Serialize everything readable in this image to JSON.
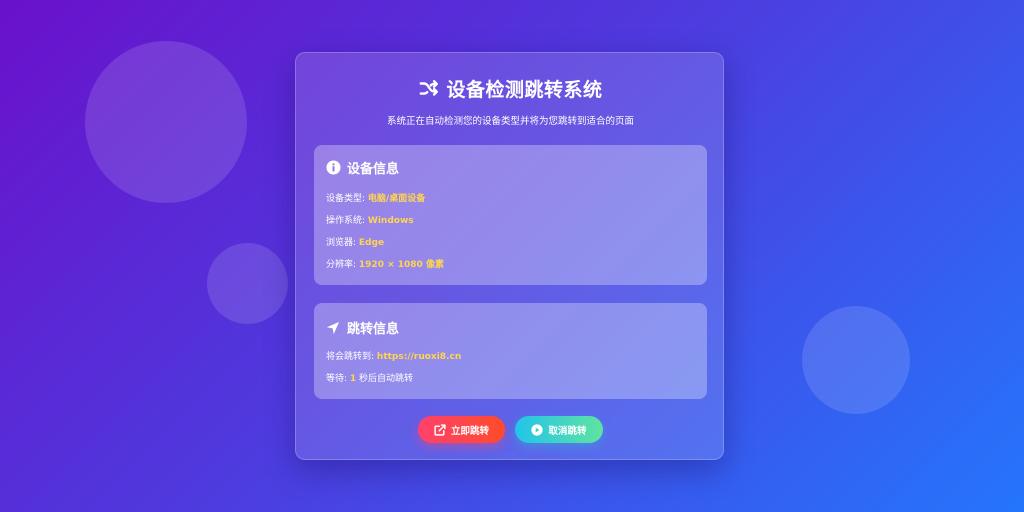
{
  "header": {
    "title": "设备检测跳转系统",
    "subtitle": "系统正在自动检测您的设备类型并将为您跳转到适合的页面",
    "icon": "shuffle-icon"
  },
  "device_panel": {
    "title": "设备信息",
    "icon": "info-circle-icon",
    "rows": [
      {
        "label": "设备类型: ",
        "value": "电脑/桌面设备"
      },
      {
        "label": "操作系统: ",
        "value": "Windows"
      },
      {
        "label": "浏览器: ",
        "value": "Edge"
      },
      {
        "label": "分辨率: ",
        "value": "1920 × 1080 像素"
      }
    ]
  },
  "redirect_panel": {
    "title": "跳转信息",
    "icon": "location-arrow-icon",
    "target_label": "将会跳转到: ",
    "target_url": "https://ruoxi8.cn",
    "wait_label": "等待: ",
    "wait_seconds": "1",
    "wait_suffix": " 秒后自动跳转"
  },
  "buttons": {
    "go_now": "立即跳转",
    "go_now_icon": "external-link-icon",
    "cancel": "取消跳转",
    "cancel_icon": "play-circle-icon"
  },
  "colors": {
    "gradient_start": "#6a11cb",
    "gradient_end": "#2575fc",
    "highlight": "#ffd54f",
    "go_button": "#ff416c",
    "cancel_button_start": "#22c4ea",
    "cancel_button_end": "#5fe3a1"
  }
}
